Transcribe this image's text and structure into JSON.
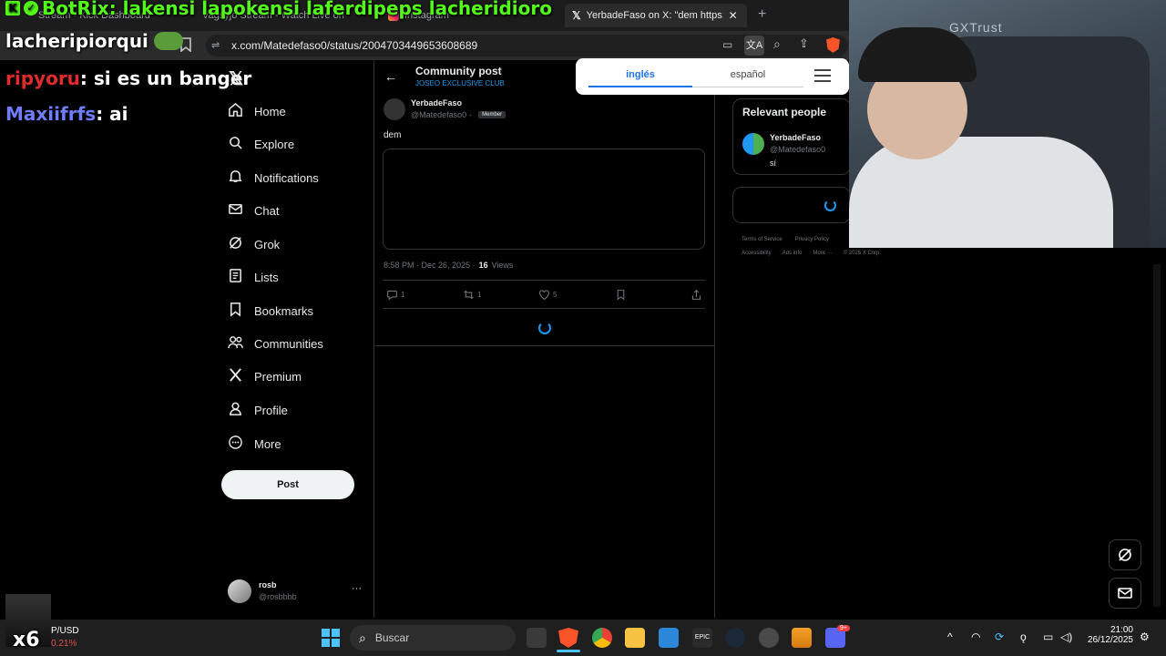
{
  "browser": {
    "tabs": [
      {
        "label": "Stream - Kick Dashboard"
      },
      {
        "label": "Vagsyjo Stream - Watch Live on"
      },
      {
        "label": "Instagram"
      },
      {
        "label": "YerbadeFaso on X: \"dem https://"
      }
    ],
    "url": "x.com/Matedefaso0/status/2004703449653608689"
  },
  "overlay": {
    "botrix_line": "BotRix: lakensi lapokensi laferdipeps lacheridioro",
    "line2": "lacheripiorqui",
    "chat": [
      {
        "user": "ripyoru",
        "msg": ": si es un banger",
        "color": "#e02b2b"
      },
      {
        "user": "Maxiifrfs",
        "msg": ": ai",
        "color": "#6f7dff"
      }
    ],
    "stock_symbol": "P/USD",
    "stock_change": "0.21%",
    "multiplier": "x6",
    "webcam_brand": "GXTrust"
  },
  "x_sidebar": {
    "nav": [
      {
        "label": "Home",
        "icon": "home-icon"
      },
      {
        "label": "Explore",
        "icon": "search-icon"
      },
      {
        "label": "Notifications",
        "icon": "bell-icon"
      },
      {
        "label": "Chat",
        "icon": "mail-icon"
      },
      {
        "label": "Grok",
        "icon": "grok-icon"
      },
      {
        "label": "Lists",
        "icon": "list-icon"
      },
      {
        "label": "Bookmarks",
        "icon": "bookmark-icon"
      },
      {
        "label": "Communities",
        "icon": "communities-icon"
      },
      {
        "label": "Premium",
        "icon": "x-logo-icon"
      },
      {
        "label": "Profile",
        "icon": "person-icon"
      },
      {
        "label": "More",
        "icon": "more-icon"
      }
    ],
    "post_label": "Post",
    "account": {
      "name": "rosb",
      "handle": "@rosbbbb"
    }
  },
  "post_view": {
    "header_title": "Community post",
    "community": "JOSEO EXCLUSIVE CLUB",
    "author_name": "YerbadeFaso",
    "author_handle": "@Matedefaso0",
    "sep": "·",
    "member_badge": "Member",
    "text": "dem",
    "timestamp": "8:58 PM · Dec 26, 2025 ·",
    "views_count": "16",
    "views_label": "Views",
    "replies": "1",
    "reposts": "1",
    "likes": "5"
  },
  "right_col": {
    "relevant_title": "Relevant people",
    "person_name": "YerbadeFaso",
    "person_handle": "@Matedefaso0",
    "person_bio": "sí",
    "footer1": [
      "Terms of Service",
      "Privacy Policy"
    ],
    "footer2": [
      "Accessibility",
      "Ads info",
      "More ···",
      "© 2025 X Corp."
    ]
  },
  "translate_popup": {
    "tab_active": "inglés",
    "tab_other": "español"
  },
  "taskbar": {
    "search_placeholder": "Buscar",
    "time": "21:00",
    "date": "26/12/2025",
    "discord_badge": "9+"
  },
  "colors": {
    "x_blue": "#1d9bf0",
    "translate_accent": "#1a73e8",
    "brave_orange": "#fb542b"
  }
}
